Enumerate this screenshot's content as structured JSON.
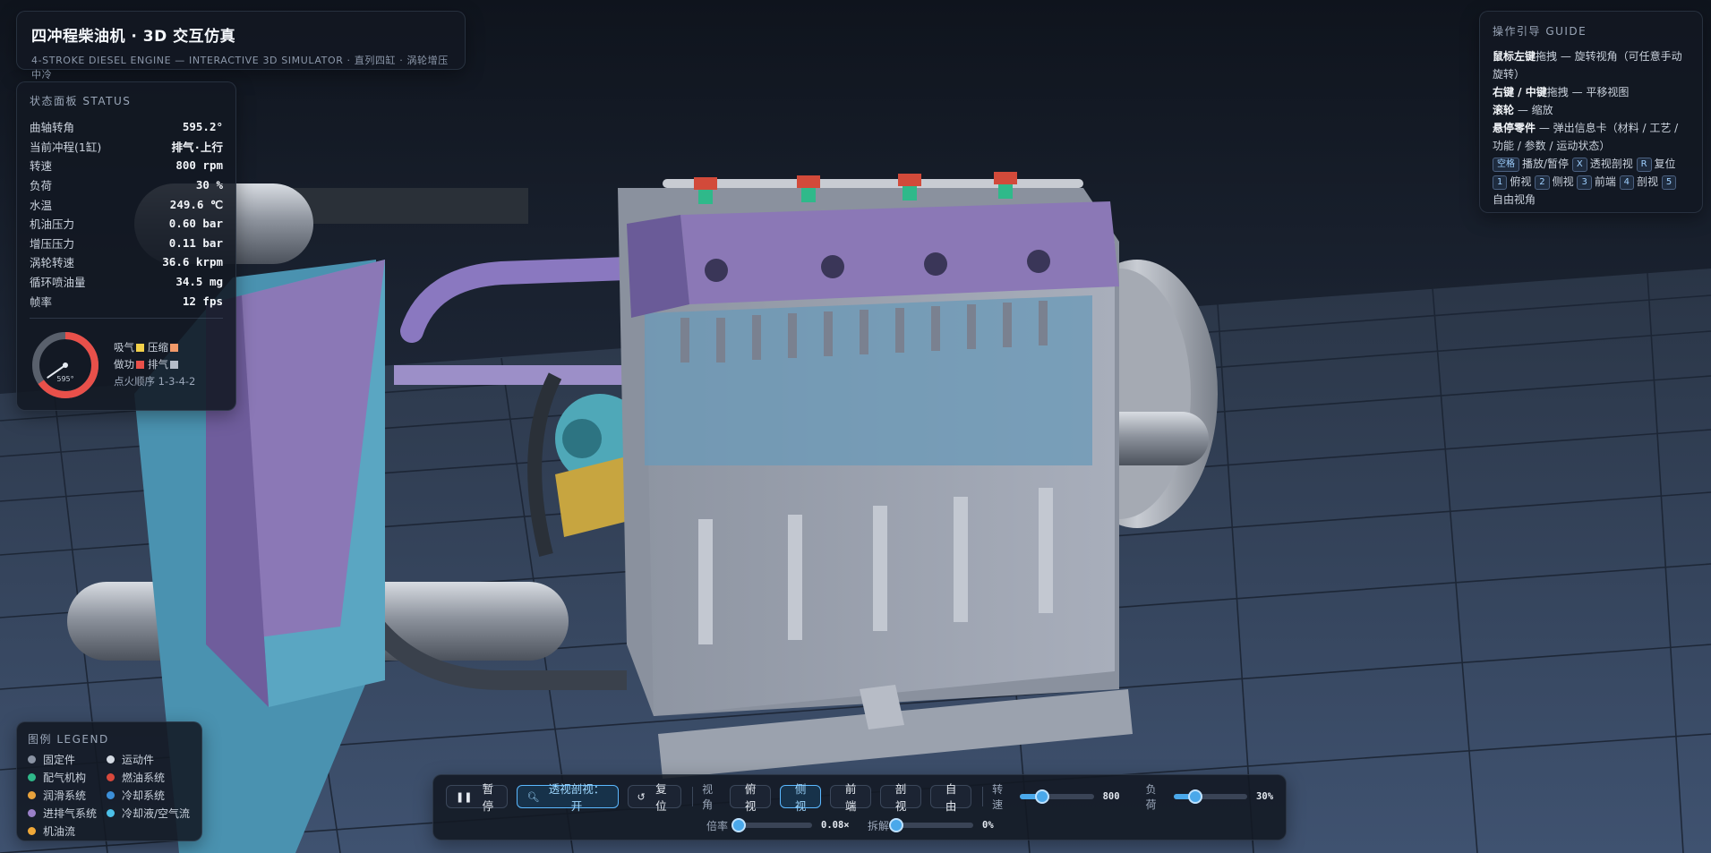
{
  "header": {
    "title": "四冲程柴油机 · 3D 交互仿真",
    "subtitle": "4-STROKE DIESEL ENGINE — INTERACTIVE 3D SIMULATOR · 直列四缸 · 涡轮增压中冷"
  },
  "status": {
    "heading": "状态面板 STATUS",
    "rows": [
      {
        "label": "曲轴转角",
        "value": "595.2°"
      },
      {
        "label": "当前冲程(1缸)",
        "value": "排气·上行"
      },
      {
        "label": "转速",
        "value": "800 rpm"
      },
      {
        "label": "负荷",
        "value": "30 %"
      },
      {
        "label": "水温",
        "value": "249.6 ℃"
      },
      {
        "label": "机油压力",
        "value": "0.60 bar"
      },
      {
        "label": "增压压力",
        "value": "0.11 bar"
      },
      {
        "label": "涡轮转速",
        "value": "36.6 krpm"
      },
      {
        "label": "循环喷油量",
        "value": "34.5 mg"
      },
      {
        "label": "帧率",
        "value": "12 fps"
      }
    ],
    "gauge_label": "595°",
    "gauge_fraction": 0.653,
    "strokes": [
      {
        "label": "吸气",
        "color": "#f2d04a"
      },
      {
        "label": "压缩",
        "color": "#f29a6a"
      },
      {
        "label": "做功",
        "color": "#e8504a"
      },
      {
        "label": "排气",
        "color": "#b4bcc8"
      }
    ],
    "firing_order": "点火顺序 1-3-4-2"
  },
  "guide": {
    "heading": "操作引导 GUIDE",
    "l1_key": "鼠标左键",
    "l1_text": "拖拽 — 旋转视角（可任意手动旋转）",
    "l2_key": "右键 / 中键",
    "l2_text": "拖拽 — 平移视图",
    "l3_key": "滚轮",
    "l3_text": " — 缩放",
    "l4_key": "悬停零件",
    "l4_text": " — 弹出信息卡（材料 / 工艺 / 功能 / 参数 / 运动状态）",
    "k_space": "空格",
    "t_space": "播放/暂停",
    "k_x": "X",
    "t_x": "透视剖视",
    "k_r": "R",
    "t_r": "复位",
    "k_1": "1",
    "t_1": "俯视",
    "k_2": "2",
    "t_2": "侧视",
    "k_3": "3",
    "t_3": "前端",
    "k_4": "4",
    "t_4": "剖视",
    "k_5": "5",
    "t_5": "自由视角"
  },
  "legend": {
    "heading": "图例 LEGEND",
    "items": [
      {
        "label": "固定件",
        "color": "#8a93a3"
      },
      {
        "label": "运动件",
        "color": "#d4dae3"
      },
      {
        "label": "配气机构",
        "color": "#2fb98a"
      },
      {
        "label": "燃油系统",
        "color": "#d8483c"
      },
      {
        "label": "润滑系统",
        "color": "#e8a23c"
      },
      {
        "label": "冷却系统",
        "color": "#3c8fd8"
      },
      {
        "label": "进排气系统",
        "color": "#9a80c8"
      },
      {
        "label": "冷却液/空气流",
        "color": "#4cc0e8"
      },
      {
        "label": "机油流",
        "color": "#f0a838"
      }
    ]
  },
  "toolbar": {
    "pause_icon": "pause-icon",
    "pause_label": "暂停",
    "xray_label": "透视剖视：开",
    "reset_label": "复位",
    "view_label": "视角",
    "views": [
      "俯视",
      "侧视",
      "前端",
      "剖视",
      "自由"
    ],
    "active_view": "侧视",
    "speed_label": "转速",
    "speed_value": "800",
    "speed_fraction": 0.3,
    "load_label": "负荷",
    "load_value": "30%",
    "load_fraction": 0.3,
    "zoom_label": "倍率",
    "zoom_value": "0.08×",
    "zoom_fraction": 0.05,
    "explode_label": "拆解",
    "explode_value": "0%",
    "explode_fraction": 0.0
  },
  "colors": {
    "accent": "#4aa8ea",
    "panel_bg": "#121822",
    "block": "#a9afbc",
    "valve_cover": "#8b78b6",
    "radiator": "#4a96b4"
  }
}
